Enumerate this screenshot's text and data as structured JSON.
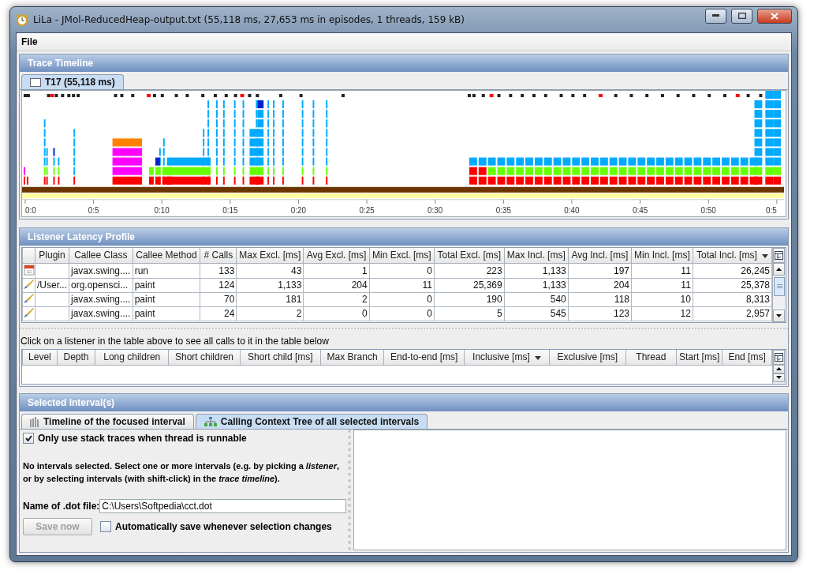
{
  "window": {
    "title": "LiLa - JMol-ReducedHeap-output.txt (55,118 ms, 27,653 ms in episodes, 1 threads, 159 kB)"
  },
  "menu": [
    "File"
  ],
  "trace_timeline": {
    "title": "Trace Timeline",
    "tab": {
      "label": "T17 (55,118 ms)",
      "selected": true
    },
    "ticks": [
      "0:0",
      "0:5",
      "0:10",
      "0:15",
      "0:20",
      "0:25",
      "0:30",
      "0:35",
      "0:40",
      "0:45",
      "0:50",
      "0:5"
    ]
  },
  "listener_profile": {
    "title": "Listener Latency Profile",
    "columns": [
      {
        "sorted": false
      },
      {
        "label": "Plugin",
        "sorted": false
      },
      {
        "label": "Callee Class",
        "sorted": false
      },
      {
        "label": "Callee Method",
        "sorted": false
      },
      {
        "label": "# Calls",
        "sorted": false
      },
      {
        "label": "Max Excl. [ms]",
        "sorted": false
      },
      {
        "label": "Avg Excl. [ms]",
        "sorted": false
      },
      {
        "label": "Min Excl. [ms]",
        "sorted": false
      },
      {
        "label": "Total Excl. [ms]",
        "sorted": false
      },
      {
        "label": "Max Incl. [ms]",
        "sorted": false
      },
      {
        "label": "Avg Incl. [ms]",
        "sorted": false
      },
      {
        "label": "Min Incl. [ms]",
        "sorted": false
      },
      {
        "label": "Total Incl. [ms]",
        "sorted": true
      }
    ],
    "rows": [
      {
        "kind": "timer",
        "cells": [
          "",
          "",
          "javax.swing....",
          "run",
          "133",
          "43",
          "1",
          "0",
          "223",
          "1,133",
          "197",
          "11",
          "26,245"
        ]
      },
      {
        "kind": "paint",
        "cells": [
          "",
          "/User...",
          "org.opensci...",
          "paint",
          "124",
          "1,133",
          "204",
          "11",
          "25,369",
          "1,133",
          "204",
          "11",
          "25,378"
        ]
      },
      {
        "kind": "paint",
        "cells": [
          "",
          "",
          "javax.swing....",
          "paint",
          "70",
          "181",
          "2",
          "0",
          "190",
          "540",
          "118",
          "10",
          "8,313"
        ]
      },
      {
        "kind": "paint",
        "cells": [
          "",
          "",
          "javax.swing....",
          "paint",
          "24",
          "2",
          "0",
          "0",
          "5",
          "545",
          "123",
          "12",
          "2,957"
        ]
      }
    ],
    "hint": "Click on a listener in the table above to see all calls to it in the table below",
    "call_columns": [
      {
        "label": "Level",
        "sorted": false
      },
      {
        "label": "Depth",
        "sorted": false
      },
      {
        "label": "Long children",
        "sorted": false
      },
      {
        "label": "Short children",
        "sorted": false
      },
      {
        "label": "Short child [ms]",
        "sorted": false
      },
      {
        "label": "Max Branch",
        "sorted": false
      },
      {
        "label": "End-to-end [ms]",
        "sorted": false
      },
      {
        "label": "Inclusive [ms]",
        "sorted": true
      },
      {
        "label": "Exclusive [ms]",
        "sorted": false
      },
      {
        "label": "Thread",
        "sorted": false
      },
      {
        "label": "Start [ms]",
        "sorted": false
      },
      {
        "label": "End [ms]",
        "sorted": false
      }
    ]
  },
  "selected_intervals": {
    "title": "Selected Interval(s)",
    "tabs": [
      {
        "label": "Timeline of the focused interval",
        "selected": false,
        "kind": "timeline"
      },
      {
        "label": "Calling Context Tree of all selected intervals",
        "selected": true,
        "kind": "tree"
      }
    ],
    "runnable_option": {
      "label": "Only use stack traces when thread is runnable",
      "checked": true
    },
    "message": "No intervals selected. Select one or more intervals (e.g. by picking a *listener*, or by selecting intervals (with shift-click) in the *trace timeline*).",
    "dot_file": {
      "label": "Name of .dot file:",
      "value": "C:\\Users\\Softpedia\\cct.dot"
    },
    "save_button": {
      "label": "Save now",
      "disabled": true
    },
    "auto_save": {
      "label": "Automatically save whenever selection changes",
      "checked": false
    }
  }
}
